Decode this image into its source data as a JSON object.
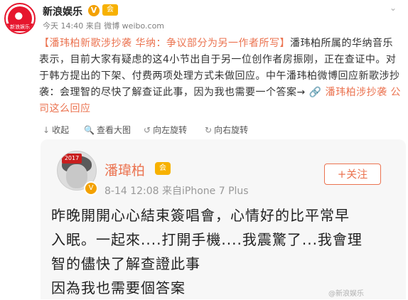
{
  "header": {
    "nickname": "新浪娱乐",
    "verified_mark": "V",
    "vip_mark": "会",
    "avatar_label": "新浪娱乐",
    "meta": "今天 14:40 来自 微博 weibo.com",
    "menu_caret": "⌄"
  },
  "post": {
    "title_link": "【潘玮柏新歌涉抄袭 华纳：争议部分为另一作者所写】",
    "body": "潘玮柏所属的华纳音乐表示，目前大家有疑虑的这4小节出自于另一位创作者房振刚，正在查证中。对于韩方提出的下架、付费两项处理方式未做回应。中午潘玮柏微博回应新歌涉抄袭：会理智的尽快了解查证此事，因为我也需要一个答案→",
    "link_icon": "🔗",
    "topic_link": "潘玮柏涉抄袭 公司这么回应"
  },
  "actions": [
    {
      "icon": "↓",
      "label": "收起"
    },
    {
      "icon": "🔍",
      "label": "查看大图"
    },
    {
      "icon": "↺",
      "label": "向左旋转"
    },
    {
      "icon": "↻",
      "label": "向右旋转"
    }
  ],
  "embed": {
    "avatar_badge": "2017",
    "verified_mark": "V",
    "name": "潘瑋柏",
    "vip_mark": "会",
    "meta": "8-14 12:08  来自iPhone 7 Plus",
    "follow_label": "+关注",
    "text_lines": [
      "昨晚開開心心結束簽唱會，心情好的比平常早",
      "入眠。一起來....打開手機....我震驚了...我會理",
      "智的儘快了解查證此事",
      "因為我也需要個答案"
    ],
    "watermark": "@新浪娱乐"
  }
}
